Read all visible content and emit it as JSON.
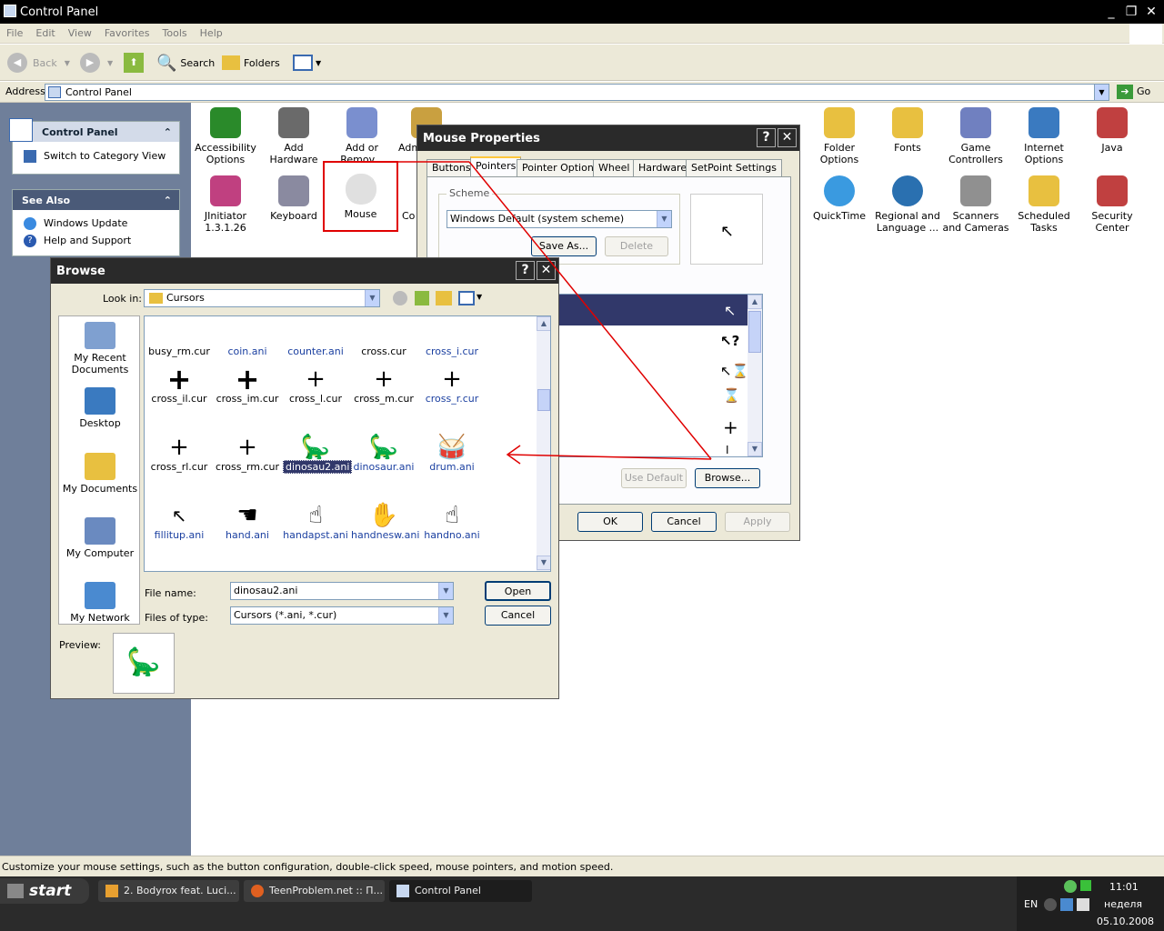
{
  "window": {
    "title": "Control Panel",
    "min": "_",
    "max": "❐",
    "close": "✕"
  },
  "menu": [
    "File",
    "Edit",
    "View",
    "Favorites",
    "Tools",
    "Help"
  ],
  "toolbar": {
    "back": "Back",
    "search": "Search",
    "folders": "Folders"
  },
  "address": {
    "label": "Address",
    "value": "Control Panel",
    "go": "Go"
  },
  "sidebar": {
    "control_panel": {
      "title": "Control Panel",
      "items": [
        "Switch to Category View"
      ]
    },
    "see_also": {
      "title": "See Also",
      "items": [
        "Windows Update",
        "Help and Support"
      ]
    }
  },
  "icons": [
    {
      "label": "Accessibility Options",
      "color": "#2a8a2a"
    },
    {
      "label": "Add Hardware",
      "color": "#6a6a6a"
    },
    {
      "label": "Add or Remov...",
      "color": "#7a8fcf"
    },
    {
      "label": "Adm",
      "color": "#c9a040"
    },
    {
      "label": "JInitiator 1.3.1.26",
      "color": "#c04080"
    },
    {
      "label": "Keyboard",
      "color": "#8a8aa0"
    },
    {
      "label": "Mouse",
      "color": "#d0d0d0"
    },
    {
      "label": "Co",
      "color": "#aaa"
    },
    {
      "label": "Folder Options",
      "color": "#e8c040"
    },
    {
      "label": "Fonts",
      "color": "#e8c040"
    },
    {
      "label": "Game Controllers",
      "color": "#7080c0"
    },
    {
      "label": "Internet Options",
      "color": "#3a7ac0"
    },
    {
      "label": "Java",
      "color": "#c04040"
    },
    {
      "label": "QuickTime",
      "color": "#3a9ae0"
    },
    {
      "label": "Regional and Language ...",
      "color": "#2a70b0"
    },
    {
      "label": "Scanners and Cameras",
      "color": "#909090"
    },
    {
      "label": "Scheduled Tasks",
      "color": "#e8c040"
    },
    {
      "label": "Security Center",
      "color": "#c04040"
    }
  ],
  "status": "Customize your mouse settings, such as the button configuration, double-click speed, mouse pointers, and motion speed.",
  "taskbar": {
    "start": "start",
    "tasks": [
      "2. Bodyrox feat. Luci...",
      "TeenProblem.net :: П...",
      "Control Panel"
    ],
    "tray": {
      "lang": "EN",
      "time": "11:01",
      "day": "неделя",
      "date": "05.10.2008"
    }
  },
  "mouse_dialog": {
    "title": "Mouse Properties",
    "help": "?",
    "close": "✕",
    "tabs": [
      "Buttons",
      "Pointers",
      "Pointer Options",
      "Wheel",
      "Hardware",
      "SetPoint Settings"
    ],
    "scheme_label": "Scheme",
    "scheme_value": "Windows Default (system scheme)",
    "save_as": "Save As...",
    "delete": "Delete",
    "use_default": "Use Default",
    "browse": "Browse...",
    "ok": "OK",
    "cancel": "Cancel",
    "apply": "Apply"
  },
  "browse_dialog": {
    "title": "Browse",
    "help": "?",
    "close": "✕",
    "look_in_label": "Look in:",
    "look_in_value": "Cursors",
    "places": [
      "My Recent Documents",
      "Desktop",
      "My Documents",
      "My Computer",
      "My Network"
    ],
    "files": [
      {
        "name": "busy_rm.cur",
        "glyph": "",
        "color": "#000"
      },
      {
        "name": "coin.ani",
        "glyph": "",
        "color": "#1a3fa0"
      },
      {
        "name": "counter.ani",
        "glyph": "",
        "color": "#1a3fa0"
      },
      {
        "name": "cross.cur",
        "glyph": "",
        "color": "#000"
      },
      {
        "name": "cross_i.cur",
        "glyph": "",
        "color": "#1a3fa0"
      },
      {
        "name": "cross_il.cur",
        "glyph": "+",
        "color": "#000"
      },
      {
        "name": "cross_im.cur",
        "glyph": "+",
        "color": "#000"
      },
      {
        "name": "cross_l.cur",
        "glyph": "+",
        "color": "#000"
      },
      {
        "name": "cross_m.cur",
        "glyph": "+",
        "color": "#000"
      },
      {
        "name": "cross_r.cur",
        "glyph": "+",
        "color": "#1a3fa0"
      },
      {
        "name": "cross_rl.cur",
        "glyph": "+",
        "color": "#000"
      },
      {
        "name": "cross_rm.cur",
        "glyph": "+",
        "color": "#000"
      },
      {
        "name": "dinosau2.ani",
        "glyph": "🦕",
        "color": "#fff"
      },
      {
        "name": "dinosaur.ani",
        "glyph": "🦕",
        "color": "#1a3fa0"
      },
      {
        "name": "drum.ani",
        "glyph": "🥁",
        "color": "#1a3fa0"
      },
      {
        "name": "fillitup.ani",
        "glyph": "↖",
        "color": "#1a3fa0"
      },
      {
        "name": "hand.ani",
        "glyph": "☚",
        "color": "#1a3fa0"
      },
      {
        "name": "handapst.ani",
        "glyph": "☝",
        "color": "#1a3fa0"
      },
      {
        "name": "handnesw.ani",
        "glyph": "✋",
        "color": "#1a3fa0"
      },
      {
        "name": "handno.ani",
        "glyph": "☝",
        "color": "#1a3fa0"
      }
    ],
    "file_name_label": "File name:",
    "file_name_value": "dinosau2.ani",
    "files_of_type_label": "Files of type:",
    "files_of_type_value": "Cursors (*.ani, *.cur)",
    "open": "Open",
    "cancel": "Cancel",
    "preview_label": "Preview:"
  }
}
